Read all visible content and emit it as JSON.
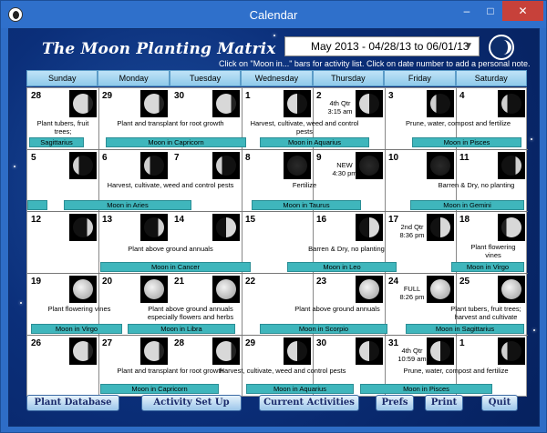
{
  "window": {
    "title": "Calendar",
    "minimize": "–",
    "maximize": "□",
    "close": "✕"
  },
  "app": {
    "title": "The Moon Planting Matrix",
    "date_range": "May 2013 - 04/28/13 to 06/01/13",
    "hint": "Click on \"Moon in...\" bars for activity list.  Click on date number to add a personal note."
  },
  "days": [
    "Sunday",
    "Monday",
    "Tuesday",
    "Wednesday",
    "Thursday",
    "Friday",
    "Saturday"
  ],
  "weeks": [
    {
      "dates": [
        "28",
        "29",
        "30",
        "1",
        "2",
        "3",
        "4"
      ],
      "phase": {
        "label": "4th Qtr",
        "time": "3:15 am"
      },
      "activities": [
        "Plant tubers, fruit trees;",
        "Plant and transplant for root growth",
        "Harvest, cultivate, weed and control pests",
        "Prune, water, compost and fertilize"
      ],
      "bars": [
        "Sagittarius",
        "Moon in Capricorn",
        "Moon in Aquarius",
        "Moon in Pisces"
      ]
    },
    {
      "dates": [
        "5",
        "6",
        "7",
        "8",
        "9",
        "10",
        "11"
      ],
      "phase": {
        "label": "NEW",
        "time": "4:30 pm"
      },
      "activities": [
        "Harvest, cultivate, weed and control pests",
        "Fertilize",
        "Barren & Dry, no planting"
      ],
      "bars": [
        "Moon in Aries",
        "Moon in Taurus",
        "Moon in Gemini"
      ]
    },
    {
      "dates": [
        "12",
        "13",
        "14",
        "15",
        "16",
        "17",
        "18"
      ],
      "phase": {
        "label": "2nd Qtr",
        "time": "8:36 pm"
      },
      "activities": [
        "Plant above ground annuals",
        "Barren & Dry, no planting",
        "Plant flowering vines"
      ],
      "bars": [
        "Moon in Cancer",
        "Moon in Leo",
        "Moon in Virgo"
      ]
    },
    {
      "dates": [
        "19",
        "20",
        "21",
        "22",
        "23",
        "24",
        "25"
      ],
      "phase": {
        "label": "FULL",
        "time": "8:26 pm"
      },
      "activities": [
        "Plant flowering vines",
        "Plant above ground annuals especially flowers and herbs",
        "Plant above ground annuals",
        "Plant tubers, fruit trees; harvest and cultivate"
      ],
      "bars": [
        "Moon in Virgo",
        "Moon in Libra",
        "Moon in Scorpio",
        "Moon in Sagittarius"
      ]
    },
    {
      "dates": [
        "26",
        "27",
        "28",
        "29",
        "30",
        "31",
        "1"
      ],
      "phase": {
        "label": "4th Qtr",
        "time": "10:59 am"
      },
      "activities": [
        "Plant and transplant for root growth",
        "Harvest, cultivate, weed and control pests",
        "Prune, water, compost and fertilize"
      ],
      "bars": [
        "Moon in Capricorn",
        "Moon in Aquarius",
        "Moon in Pisces"
      ]
    }
  ],
  "buttons": {
    "plant_db": "Plant Database",
    "activity_setup": "Activity Set Up",
    "current": "Current Activities",
    "prefs": "Prefs",
    "print": "Print",
    "quit": "Quit"
  }
}
